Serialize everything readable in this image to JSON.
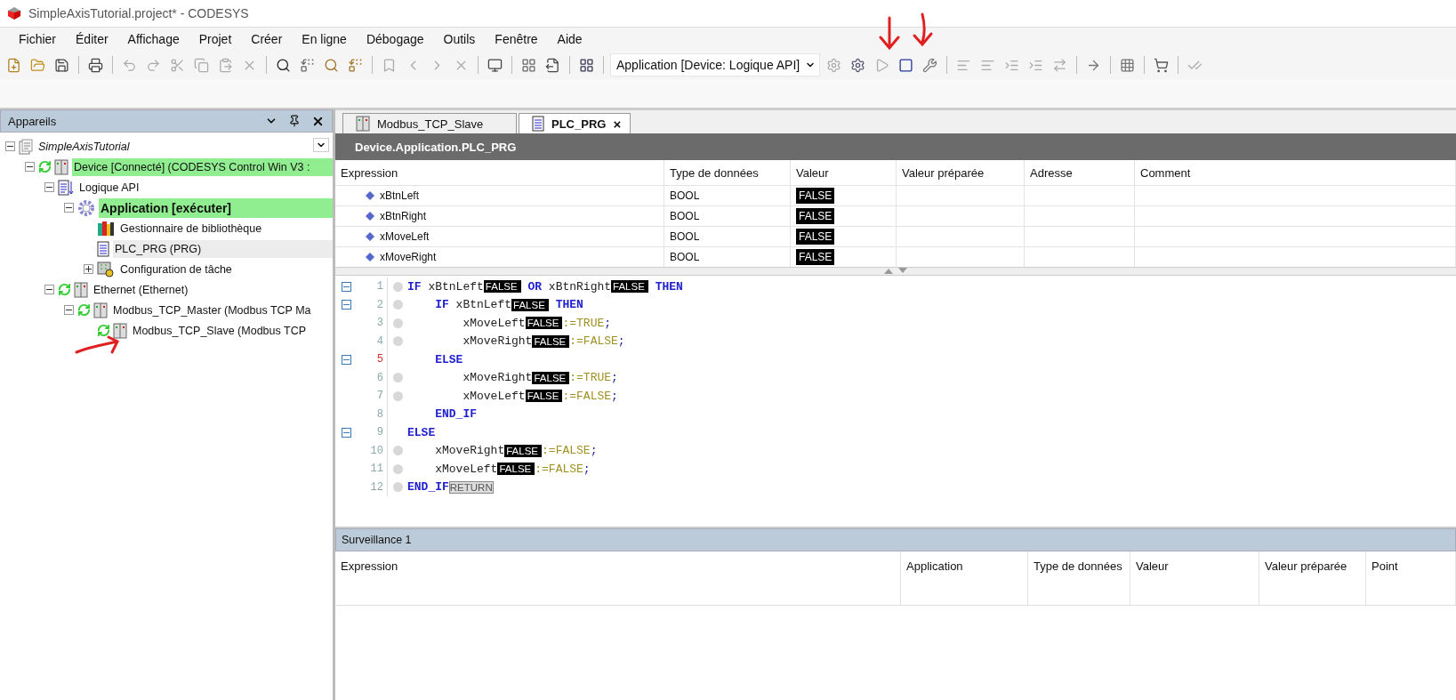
{
  "window": {
    "title": "SimpleAxisTutorial.project* - CODESYS"
  },
  "menu": [
    "Fichier",
    "Éditer",
    "Affichage",
    "Projet",
    "Créer",
    "En ligne",
    "Débogage",
    "Outils",
    "Fenêtre",
    "Aide"
  ],
  "toolbar": {
    "application_select": "Application [Device: Logique API]"
  },
  "devices_panel": {
    "title": "Appareils",
    "tree": [
      {
        "label": "SimpleAxisTutorial",
        "kind": "project",
        "sync": false,
        "highlighted": false,
        "selected": false,
        "expanded": true,
        "children": [
          {
            "label": "Device [Connecté] (CODESYS Control Win V3 :",
            "kind": "device",
            "sync": true,
            "highlighted": true,
            "selected": false,
            "expanded": true,
            "children": [
              {
                "label": "Logique API",
                "kind": "logic",
                "sync": false,
                "highlighted": false,
                "selected": false,
                "expanded": true,
                "children": [
                  {
                    "label": "Application [exécuter]",
                    "kind": "application",
                    "sync": false,
                    "highlighted": true,
                    "selected": false,
                    "expanded": true,
                    "children": [
                      {
                        "label": "Gestionnaire de bibliothèque",
                        "kind": "library",
                        "sync": false,
                        "highlighted": false,
                        "selected": false
                      },
                      {
                        "label": "PLC_PRG (PRG)",
                        "kind": "pou",
                        "sync": false,
                        "highlighted": false,
                        "selected": true
                      },
                      {
                        "label": "Configuration de tâche",
                        "kind": "task",
                        "sync": false,
                        "highlighted": false,
                        "selected": false,
                        "expanded": false
                      }
                    ]
                  }
                ]
              },
              {
                "label": "Ethernet (Ethernet)",
                "kind": "device",
                "sync": true,
                "highlighted": false,
                "selected": false,
                "expanded": true,
                "children": [
                  {
                    "label": "Modbus_TCP_Master (Modbus TCP Ma",
                    "kind": "device",
                    "sync": true,
                    "highlighted": false,
                    "selected": false,
                    "expanded": true,
                    "children": [
                      {
                        "label": "Modbus_TCP_Slave (Modbus TCP",
                        "kind": "device",
                        "sync": true,
                        "highlighted": false,
                        "selected": false
                      }
                    ]
                  }
                ]
              }
            ]
          }
        ]
      }
    ]
  },
  "editor_tabs": [
    {
      "label": "Modbus_TCP_Slave",
      "kind": "device",
      "selected": false
    },
    {
      "label": "PLC_PRG",
      "kind": "pou",
      "selected": true,
      "close": "×"
    }
  ],
  "editor": {
    "path": "Device.Application.PLC_PRG",
    "columns": [
      "Expression",
      "Type de données",
      "Valeur",
      "Valeur préparée",
      "Adresse",
      "Comment"
    ],
    "variables": [
      {
        "expression": "xBtnLeft",
        "type": "BOOL",
        "value": "FALSE"
      },
      {
        "expression": "xBtnRight",
        "type": "BOOL",
        "value": "FALSE"
      },
      {
        "expression": "xMoveLeft",
        "type": "BOOL",
        "value": "FALSE"
      },
      {
        "expression": "xMoveRight",
        "type": "BOOL",
        "value": "FALSE"
      }
    ],
    "code": [
      {
        "number": "1",
        "marker": true,
        "current": false,
        "tokens": [
          {
            "kind": "keyword",
            "text": "IF"
          },
          {
            "kind": "ident",
            "text": "xBtnLeft"
          },
          {
            "kind": "value",
            "text": "FALSE"
          },
          {
            "kind": "keyword",
            "text": "OR"
          },
          {
            "kind": "ident",
            "text": "xBtnRight"
          },
          {
            "kind": "value",
            "text": "FALSE"
          },
          {
            "kind": "keyword",
            "text": "THEN"
          }
        ],
        "children": [
          {
            "number": "2",
            "marker": true,
            "current": false,
            "tokens": [
              {
                "kind": "keyword",
                "text": "IF"
              },
              {
                "kind": "ident",
                "text": "xBtnLeft"
              },
              {
                "kind": "value",
                "text": "FALSE"
              },
              {
                "kind": "keyword",
                "text": "THEN"
              }
            ],
            "children": [
              {
                "number": "3",
                "marker": true,
                "current": false,
                "tokens": [
                  {
                    "kind": "ident",
                    "text": "xMoveLeft"
                  },
                  {
                    "kind": "value",
                    "text": "FALSE"
                  },
                  {
                    "kind": "op",
                    "text": ":="
                  },
                  {
                    "kind": "literal",
                    "text": "TRUE"
                  },
                  {
                    "kind": "punct",
                    "text": ";"
                  }
                ]
              },
              {
                "number": "4",
                "marker": true,
                "current": false,
                "tokens": [
                  {
                    "kind": "ident",
                    "text": "xMoveRight"
                  },
                  {
                    "kind": "value",
                    "text": "FALSE"
                  },
                  {
                    "kind": "op",
                    "text": ":="
                  },
                  {
                    "kind": "literal",
                    "text": "FALSE"
                  },
                  {
                    "kind": "punct",
                    "text": ";"
                  }
                ]
              }
            ]
          },
          {
            "number": "5",
            "marker": false,
            "current": true,
            "tokens": [
              {
                "kind": "keyword",
                "text": "ELSE"
              }
            ],
            "children": [
              {
                "number": "6",
                "marker": true,
                "current": false,
                "tokens": [
                  {
                    "kind": "ident",
                    "text": "xMoveRight"
                  },
                  {
                    "kind": "value",
                    "text": "FALSE"
                  },
                  {
                    "kind": "op",
                    "text": ":="
                  },
                  {
                    "kind": "literal",
                    "text": "TRUE"
                  },
                  {
                    "kind": "punct",
                    "text": ";"
                  }
                ]
              },
              {
                "number": "7",
                "marker": true,
                "current": false,
                "tokens": [
                  {
                    "kind": "ident",
                    "text": "xMoveLeft"
                  },
                  {
                    "kind": "value",
                    "text": "FALSE"
                  },
                  {
                    "kind": "op",
                    "text": ":="
                  },
                  {
                    "kind": "literal",
                    "text": "FALSE"
                  },
                  {
                    "kind": "punct",
                    "text": ";"
                  }
                ]
              }
            ]
          },
          {
            "number": "8",
            "marker": false,
            "current": false,
            "tokens": [
              {
                "kind": "keyword",
                "text": "END_IF"
              }
            ]
          }
        ]
      },
      {
        "number": "9",
        "marker": false,
        "current": false,
        "tokens": [
          {
            "kind": "keyword",
            "text": "ELSE"
          }
        ],
        "children": [
          {
            "number": "10",
            "marker": true,
            "current": false,
            "tokens": [
              {
                "kind": "ident",
                "text": "xMoveRight"
              },
              {
                "kind": "value",
                "text": "FALSE"
              },
              {
                "kind": "op",
                "text": ":="
              },
              {
                "kind": "literal",
                "text": "FALSE"
              },
              {
                "kind": "punct",
                "text": ";"
              }
            ]
          },
          {
            "number": "11",
            "marker": true,
            "current": false,
            "tokens": [
              {
                "kind": "ident",
                "text": "xMoveLeft"
              },
              {
                "kind": "value",
                "text": "FALSE"
              },
              {
                "kind": "op",
                "text": ":="
              },
              {
                "kind": "literal",
                "text": "FALSE"
              },
              {
                "kind": "punct",
                "text": ";"
              }
            ]
          }
        ]
      },
      {
        "number": "12",
        "marker": true,
        "current": false,
        "tokens": [
          {
            "kind": "keyword",
            "text": "END_IF"
          },
          {
            "kind": "flow",
            "text": "RETURN"
          }
        ]
      }
    ]
  },
  "watch": {
    "title": "Surveillance 1",
    "columns": [
      "Expression",
      "Application",
      "Type de données",
      "Valeur",
      "Valeur préparée",
      "Point"
    ]
  }
}
